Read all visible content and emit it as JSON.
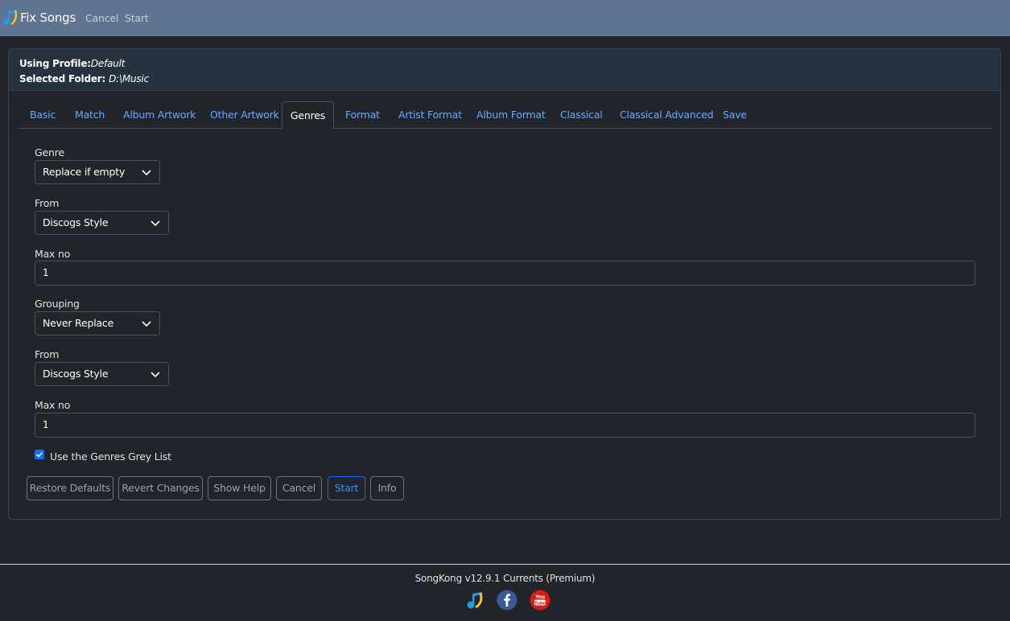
{
  "app": {
    "title": "Fix Songs"
  },
  "nav": {
    "cancel": "Cancel",
    "start": "Start"
  },
  "header": {
    "profile_label": "Using Profile:",
    "profile_value": "Default",
    "folder_label": "Selected Folder: ",
    "folder_value": "D:\\Music"
  },
  "tabs": [
    "Basic",
    "Match",
    "Album Artwork",
    "Other Artwork",
    "Genres",
    "Format",
    "Artist Format",
    "Album Format",
    "Classical",
    "Classical Advanced",
    "Save"
  ],
  "active_tab": "Genres",
  "form": {
    "genre_label": "Genre",
    "genre_value": "Replace if empty",
    "genre_from_label": "From",
    "genre_from_value": "Discogs Style",
    "genre_max_label": "Max no",
    "genre_max_value": "1",
    "grouping_label": "Grouping",
    "grouping_value": "Never Replace",
    "grouping_from_label": "From",
    "grouping_from_value": "Discogs Style",
    "grouping_max_label": "Max no",
    "grouping_max_value": "1",
    "greylist_label": "Use the Genres Grey List",
    "greylist_checked": true
  },
  "buttons": {
    "restore": "Restore Defaults",
    "revert": "Revert Changes",
    "help": "Show Help",
    "cancel": "Cancel",
    "start": "Start",
    "info": "Info"
  },
  "footer": {
    "version": "SongKong v12.9.1 Currents (Premium)"
  },
  "colors": {
    "navbar": "#5e7491",
    "accent": "#0d6efd",
    "link": "#6ea8fe",
    "background": "#212529"
  }
}
